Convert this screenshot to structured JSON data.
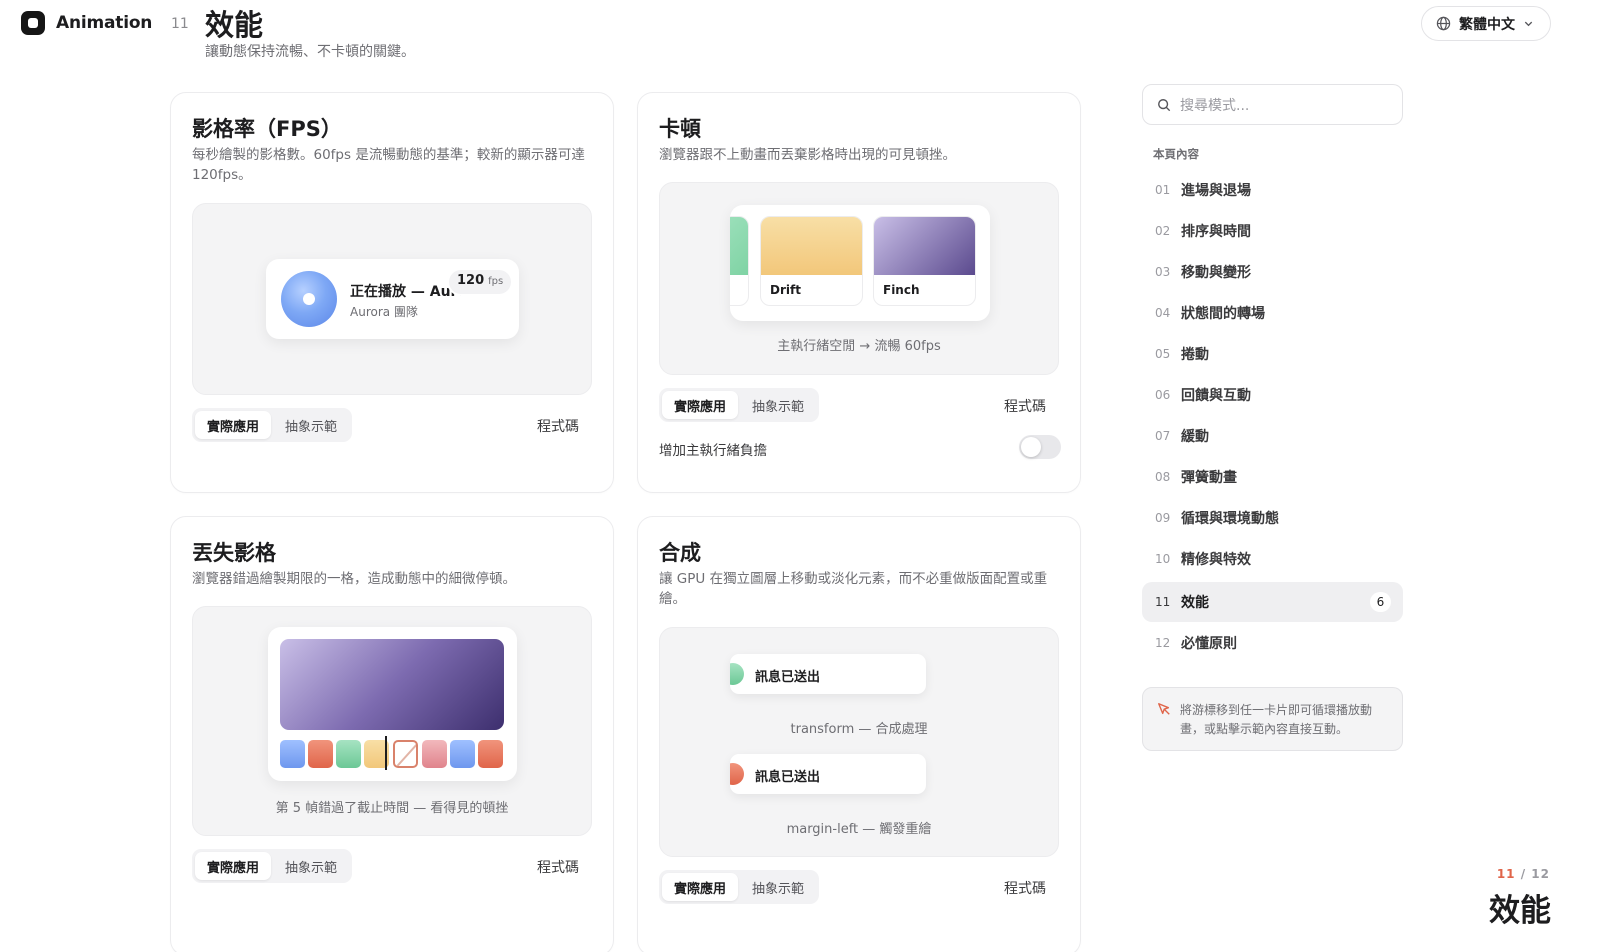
{
  "header": {
    "brand": "Animation",
    "page_number": "11",
    "title": "效能",
    "subtitle": "讓動態保持流暢、不卡頓的關鍵。",
    "language": "繁體中文"
  },
  "cards": {
    "fps": {
      "title": "影格率（FPS）",
      "description": "每秒繪製的影格數。60fps 是流暢動態的基準；較新的顯示器可達 120fps。",
      "player_title": "正在播放 — Aurora",
      "player_artist": "Aurora 團隊",
      "fps_value": "120",
      "fps_unit": "fps",
      "tab_real": "實際應用",
      "tab_abstract": "抽象示範",
      "code": "程式碼"
    },
    "jank": {
      "title": "卡頓",
      "description": "瀏覽器跟不上動畫而丟棄影格時出現的可見頓挫。",
      "tile_1": "Drift",
      "tile_2": "Finch",
      "caption": "主執行緒空閒 → 流暢 60fps",
      "tab_real": "實際應用",
      "tab_abstract": "抽象示範",
      "code": "程式碼",
      "toggle_label": "增加主執行緒負擔"
    },
    "dropped": {
      "title": "丟失影格",
      "description": "瀏覽器錯過繪製期限的一格，造成動態中的細微停頓。",
      "caption": "第 5 幀錯過了截止時間 — 看得見的頓挫",
      "tab_real": "實際應用",
      "tab_abstract": "抽象示範",
      "code": "程式碼"
    },
    "composite": {
      "title": "合成",
      "description": "讓 GPU 在獨立圖層上移動或淡化元素，而不必重做版面配置或重繪。",
      "toast_1": "訊息已送出",
      "caption_1": "transform — 合成處理",
      "toast_2": "訊息已送出",
      "caption_2": "margin-left — 觸發重繪",
      "tab_real": "實際應用",
      "tab_abstract": "抽象示範",
      "code": "程式碼"
    }
  },
  "sidebar": {
    "search_placeholder": "搜尋模式...",
    "toc_heading": "本頁內容",
    "items": [
      {
        "num": "01",
        "label": "進場與退場"
      },
      {
        "num": "02",
        "label": "排序與時間"
      },
      {
        "num": "03",
        "label": "移動與變形"
      },
      {
        "num": "04",
        "label": "狀態間的轉場"
      },
      {
        "num": "05",
        "label": "捲動"
      },
      {
        "num": "06",
        "label": "回饋與互動"
      },
      {
        "num": "07",
        "label": "緩動"
      },
      {
        "num": "08",
        "label": "彈簧動畫"
      },
      {
        "num": "09",
        "label": "循環與環境動態"
      },
      {
        "num": "10",
        "label": "精修與特效"
      },
      {
        "num": "11",
        "label": "效能",
        "count": "6",
        "active": true
      },
      {
        "num": "12",
        "label": "必懂原則"
      }
    ],
    "tip": "將游標移到任一卡片即可循環播放動畫，或點擊示範內容直接互動。"
  },
  "pager": {
    "current": "11",
    "separator": "/",
    "total": "12",
    "title": "效能"
  },
  "colors": {
    "accent": "#e0654a",
    "thumbs": [
      "#7ea8f5",
      "#e8725a",
      "#7fd3a4",
      "#f2c77a",
      "#ffffff",
      "#e89aa0",
      "#7ea8f5",
      "#e8725a"
    ]
  }
}
